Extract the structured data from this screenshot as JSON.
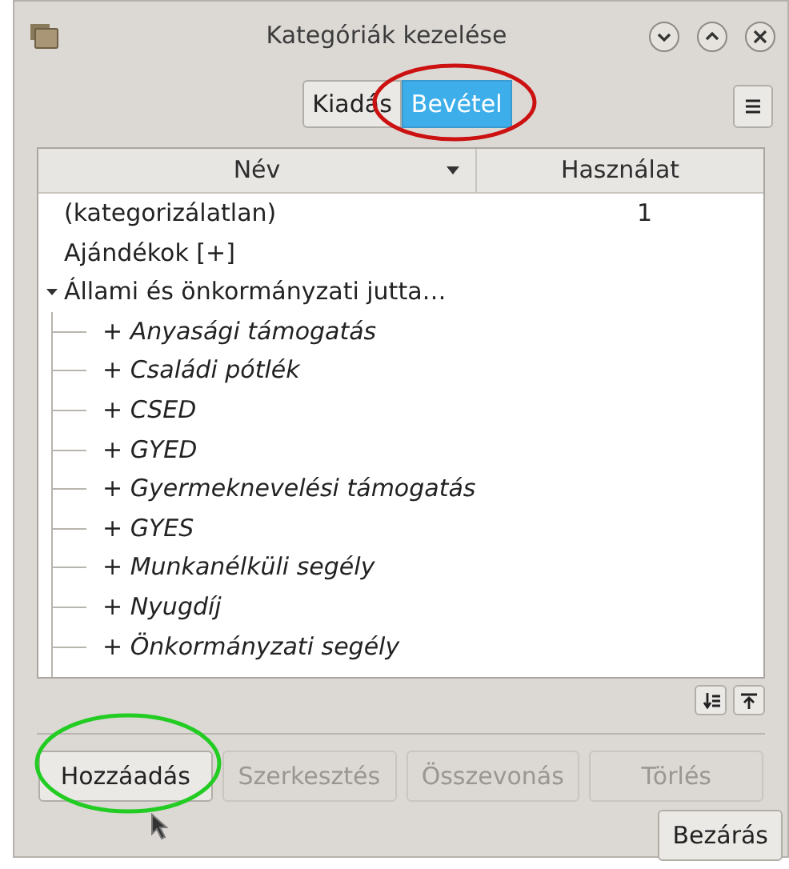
{
  "window": {
    "title": "Kategóriák kezelése"
  },
  "tabs": [
    {
      "label": "Kiadás",
      "selected": false
    },
    {
      "label": "Bevétel",
      "selected": true
    }
  ],
  "table": {
    "columns": [
      "Név",
      "Használat"
    ],
    "rows": [
      {
        "name": "(kategorizálatlan)",
        "usage": "1"
      },
      {
        "name": "Ajándékok [+]"
      },
      {
        "name": "Állami és önkormányzati jutta…",
        "expanded": true,
        "children": [
          {
            "name": "+ Anyasági támogatás"
          },
          {
            "name": "+ Családi pótlék"
          },
          {
            "name": "+ CSED"
          },
          {
            "name": "+ GYED"
          },
          {
            "name": "+ Gyermeknevelési támogatás"
          },
          {
            "name": "+ GYES"
          },
          {
            "name": "+ Munkanélküli segély"
          },
          {
            "name": "+ Nyugdíj"
          },
          {
            "name": "+ Önkormányzati segély"
          }
        ]
      }
    ]
  },
  "buttons": [
    {
      "label": "Hozzáadás",
      "disabled": false
    },
    {
      "label": "Szerkesztés",
      "disabled": true
    },
    {
      "label": "Összevonás",
      "disabled": true
    },
    {
      "label": "Törlés",
      "disabled": true
    }
  ],
  "close_button": {
    "label": "Bezárás"
  },
  "annotations": [
    {
      "kind": "ellipse",
      "color": "#cc1111"
    },
    {
      "kind": "ellipse",
      "color": "#22cc22"
    }
  ]
}
